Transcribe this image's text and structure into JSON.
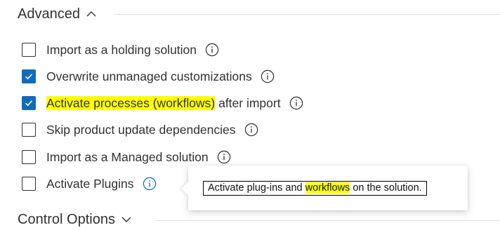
{
  "advanced": {
    "title": "Advanced",
    "expanded": true,
    "options": [
      {
        "label": "Import as a holding solution",
        "checked": false
      },
      {
        "label": "Overwrite unmanaged customizations",
        "checked": true
      },
      {
        "label_highlighted": "Activate processes (workflows)",
        "label_rest": " after import",
        "checked": true
      },
      {
        "label": "Skip product update dependencies",
        "checked": false
      },
      {
        "label": "Import as a Managed solution",
        "checked": false
      },
      {
        "label": "Activate Plugins",
        "checked": false
      }
    ]
  },
  "tooltip": {
    "text_before": "Activate plug-ins and ",
    "text_highlighted": "workflows",
    "text_after": " on the solution."
  },
  "control_options": {
    "title": "Control Options",
    "expanded": false
  },
  "colors": {
    "accent": "#0f6cbd",
    "highlight": "#ffff00",
    "info_icon_active": "#0f6cbd",
    "info_icon": "#323130"
  },
  "icons": {
    "expanded_chevron": "chevron-up-icon",
    "collapsed_chevron": "chevron-down-icon",
    "info": "info-icon",
    "check": "check-icon"
  }
}
